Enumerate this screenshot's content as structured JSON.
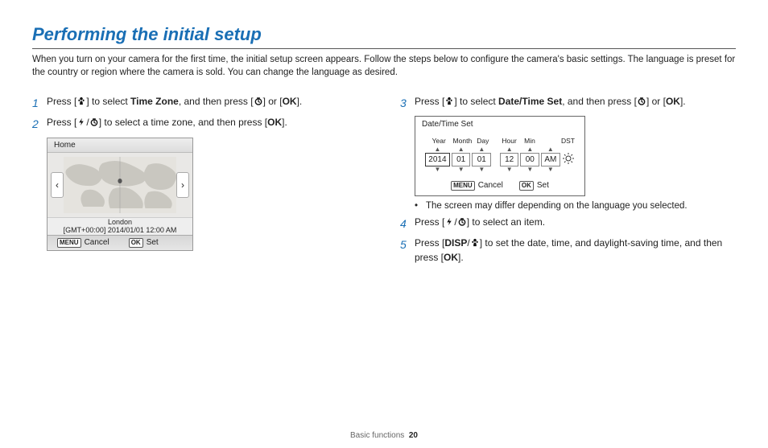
{
  "title": "Performing the initial setup",
  "intro": "When you turn on your camera for the first time, the initial setup screen appears. Follow the steps below to configure the camera's basic settings. The language is preset for the country or region where the camera is sold. You can change the language as desired.",
  "steps": {
    "s1": {
      "num": "1",
      "pre": "Press [",
      "mid1": "] to select ",
      "bold": "Time Zone",
      "mid2": ", and then press [",
      "mid3": "] or [",
      "end": "]."
    },
    "s2": {
      "num": "2",
      "pre": "Press [",
      "mid1": "/",
      "mid2": "] to select a time zone, and then press [",
      "end": "]."
    },
    "s3": {
      "num": "3",
      "pre": "Press [",
      "mid1": "] to select ",
      "bold": "Date/Time Set",
      "mid2": ", and then press [",
      "mid3": "] or [",
      "end": "]."
    },
    "s4": {
      "num": "4",
      "pre": "Press [",
      "mid1": "/",
      "end": "] to select an item."
    },
    "s5": {
      "num": "5",
      "pre": "Press [",
      "mid1": "/",
      "mid2": "] to set the date, time, and daylight-saving time, and then press [",
      "end": "]."
    }
  },
  "shot1": {
    "title": "Home",
    "city": "London",
    "gmt": "[GMT+00:00] 2014/01/01 12:00 AM",
    "cancel_lbl": "MENU",
    "cancel": "Cancel",
    "set_lbl": "OK",
    "set": "Set"
  },
  "shot2": {
    "title": "Date/Time Set",
    "headers": {
      "year": "Year",
      "month": "Month",
      "day": "Day",
      "hour": "Hour",
      "min": "Min",
      "dst": "DST"
    },
    "vals": {
      "year": "2014",
      "month": "01",
      "day": "01",
      "hour": "12",
      "min": "00",
      "ampm": "AM"
    },
    "cancel_lbl": "MENU",
    "cancel": "Cancel",
    "set_lbl": "OK",
    "set": "Set"
  },
  "bullet1": "The screen may differ depending on the language you selected.",
  "footer": {
    "section": "Basic functions",
    "page": "20"
  },
  "ok_text": "OK",
  "disp_text": "DISP"
}
